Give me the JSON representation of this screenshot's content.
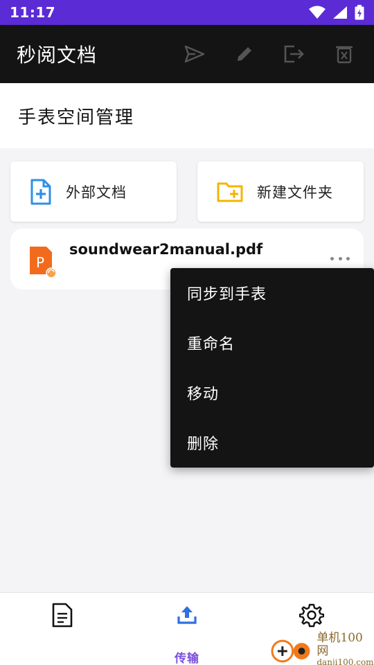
{
  "status_bar": {
    "time": "11:17"
  },
  "app_bar": {
    "title": "秒阅文档",
    "actions": [
      "send-icon",
      "edit-icon",
      "exit-icon",
      "delete-icon"
    ]
  },
  "section": {
    "title": "手表空间管理"
  },
  "cards": [
    {
      "label": "外部文档",
      "icon": "add-document-icon",
      "color": "#2f8fe6"
    },
    {
      "label": "新建文件夹",
      "icon": "add-folder-icon",
      "color": "#f5b400"
    }
  ],
  "files": [
    {
      "name": "soundwear2manual.pdf",
      "icon": "ppt-file-icon",
      "color": "#f26b1d"
    }
  ],
  "context_menu": {
    "items": [
      "同步到手表",
      "重命名",
      "移动",
      "删除"
    ]
  },
  "bottom_nav": {
    "items": [
      {
        "icon": "document-icon",
        "label": ""
      },
      {
        "icon": "upload-icon",
        "label": "传输",
        "active": true
      },
      {
        "icon": "settings-icon",
        "label": ""
      }
    ],
    "active_color": "#7b4fe0"
  },
  "watermark": {
    "main": "单机100网",
    "sub": "danji100.com"
  }
}
